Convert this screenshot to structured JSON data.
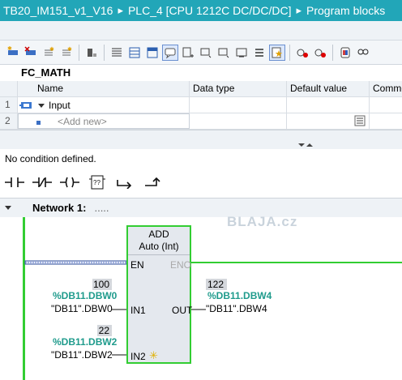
{
  "breadcrumb": {
    "items": [
      "TB20_IM151_v1_V16",
      "PLC_4 [CPU 1212C DC/DC/DC]",
      "Program blocks"
    ],
    "separator": "▸"
  },
  "block_title": "FC_MATH",
  "interface_table": {
    "headers": [
      "Name",
      "Data type",
      "Default value",
      "Comme"
    ],
    "rows": [
      {
        "num": "1",
        "name": "Input",
        "type": "",
        "default": ""
      },
      {
        "num": "2",
        "name": "<Add new>",
        "type": "",
        "default": ""
      }
    ]
  },
  "condition_text": "No condition defined.",
  "network": {
    "label": "Network 1:",
    "comment": ".....",
    "watermark": "BLAJA.cz"
  },
  "block": {
    "name": "ADD",
    "subtitle": "Auto (Int)",
    "en": "EN",
    "eno": "ENO",
    "in1": "IN1",
    "in2": "IN2",
    "out": "OUT"
  },
  "operands": {
    "in1": {
      "value": "100",
      "address": "%DB11.DBW0",
      "symbol": "\"DB11\".DBW0"
    },
    "in2": {
      "value": "22",
      "address": "%DB11.DBW2",
      "symbol": "\"DB11\".DBW2"
    },
    "out": {
      "value": "122",
      "address": "%DB11.DBW4",
      "symbol": "\"DB11\".DBW4"
    }
  },
  "colors": {
    "header": "#22a6b8",
    "wire": "#32cd32",
    "operand": "#1f9b8c"
  }
}
